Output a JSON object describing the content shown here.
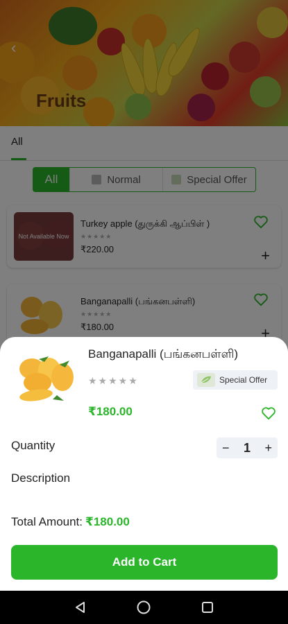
{
  "header": {
    "title": "Fruits",
    "back_icon": "arrow-left-icon"
  },
  "tabs": [
    {
      "label": "All",
      "active": true
    }
  ],
  "filter": {
    "options": [
      {
        "label": "All",
        "selected": true,
        "icon": ""
      },
      {
        "label": "Normal",
        "selected": false,
        "icon": "grid-icon"
      },
      {
        "label": "Special Offer",
        "selected": false,
        "icon": "leaf-icon"
      }
    ]
  },
  "products": [
    {
      "name": "Turkey apple (துருக்கி ஆப்பிள் )",
      "price": "₹220.00",
      "rating_stars": "★★★★★",
      "rating": 0,
      "availability_overlay": "Not Available Now"
    },
    {
      "name": "Banganapalli (பங்கனபள்ளி)",
      "price": "₹180.00",
      "rating_stars": "★★★★★",
      "rating": 0
    }
  ],
  "detail_sheet": {
    "product_name": "Banganapalli (பங்கனபள்ளி)",
    "rating_stars": "★★★★★",
    "rating": 0,
    "badge": "Special Offer",
    "price": "₹180.00",
    "quantity_label": "Quantity",
    "quantity": "1",
    "minus": "−",
    "plus": "+",
    "description_label": "Description",
    "total_label": "Total Amount:",
    "total_amount": "₹180.00",
    "add_to_cart": "Add to Cart"
  },
  "colors": {
    "accent": "#2bb52b",
    "scrim": "rgba(0,0,0,0.5)",
    "stepper_bg": "#eef1f6"
  }
}
